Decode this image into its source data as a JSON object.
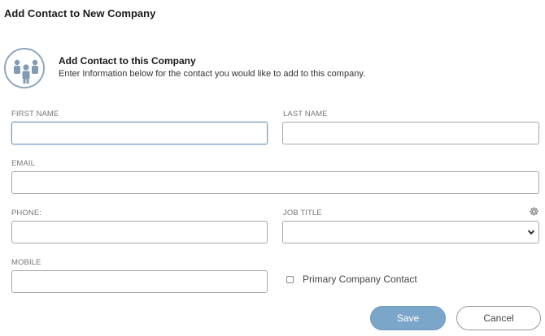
{
  "dialog": {
    "title": "Add Contact to New Company"
  },
  "section": {
    "icon": "people-group-icon",
    "title": "Add Contact to this Company",
    "description": "Enter Information below for the contact you would like to add to this company."
  },
  "form": {
    "first_name": {
      "label": "FIRST NAME",
      "value": ""
    },
    "last_name": {
      "label": "LAST NAME",
      "value": ""
    },
    "email": {
      "label": "EMAIL",
      "value": ""
    },
    "phone": {
      "label": "PHONE:",
      "value": ""
    },
    "job_title": {
      "label": "JOB TITLE",
      "selected": "",
      "settings_icon": "gear-icon"
    },
    "mobile": {
      "label": "MOBILE",
      "value": ""
    },
    "primary_contact": {
      "label": "Primary Company Contact",
      "checked": false
    }
  },
  "buttons": {
    "save": "Save",
    "cancel": "Cancel"
  },
  "colors": {
    "save_bg": "#7ba6c9",
    "focus_border": "#7a9fc2",
    "icon_color": "#8ea7bd"
  }
}
